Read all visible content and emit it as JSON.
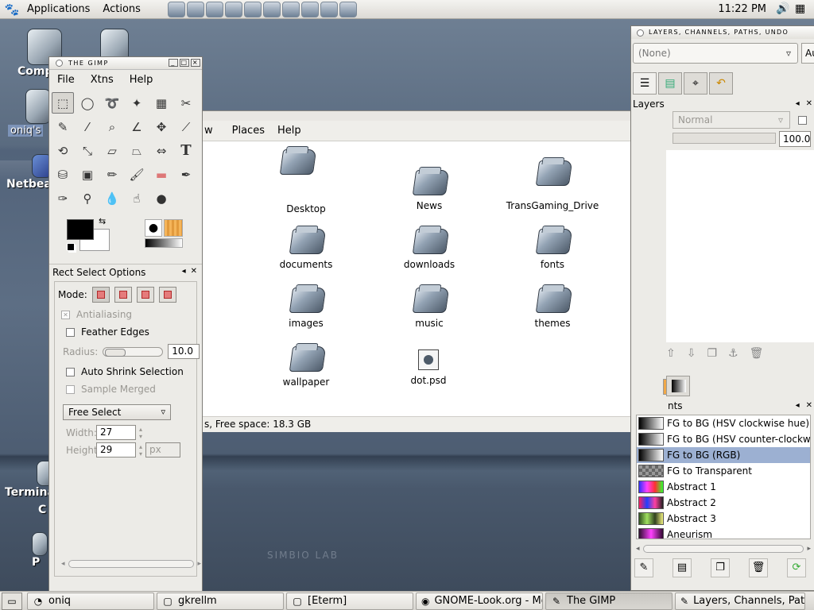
{
  "top_panel": {
    "menus": [
      "Applications",
      "Actions"
    ],
    "clock": "11:22 PM"
  },
  "desktop": {
    "icons": [
      "Comp",
      "oniq's",
      "Netbea",
      "Terminal",
      "C",
      "P"
    ],
    "watermark": "SIMBIO LAB"
  },
  "nautilus": {
    "menus": [
      "w",
      "Places",
      "Help"
    ],
    "files": [
      "Desktop",
      "News",
      "TransGaming_Drive",
      "documents",
      "downloads",
      "fonts",
      "images",
      "music",
      "themes",
      "wallpaper",
      "dot.psd"
    ],
    "status": "s, Free space: 18.3 GB"
  },
  "gimp": {
    "title": "THE GIMP",
    "menus": [
      "File",
      "Xtns",
      "Help"
    ],
    "tool_options_title": "Rect Select Options",
    "mode_label": "Mode:",
    "antialiasing": "Antialiasing",
    "feather_edges": "Feather Edges",
    "radius_label": "Radius:",
    "radius_value": "10.0",
    "auto_shrink": "Auto Shrink Selection",
    "sample_merged": "Sample Merged",
    "select_mode": "Free Select",
    "width_label": "Width:",
    "width_value": "27",
    "height_label": "Height:",
    "height_value": "29",
    "unit": "px"
  },
  "layers_dock": {
    "title": "LAYERS, CHANNELS, PATHS, UNDO",
    "image_combo": "(None)",
    "auto_btn": "Au",
    "layers_label": "Layers",
    "mode": "Normal",
    "opacity": "100.0",
    "gradients_label": "nts",
    "gradients": [
      {
        "name": "FG to BG (HSV clockwise hue)",
        "selected": false
      },
      {
        "name": "FG to BG (HSV counter-clockwise",
        "selected": false
      },
      {
        "name": "FG to BG (RGB)",
        "selected": true
      },
      {
        "name": "FG to Transparent",
        "selected": false
      },
      {
        "name": "Abstract 1",
        "selected": false
      },
      {
        "name": "Abstract 2",
        "selected": false
      },
      {
        "name": "Abstract 3",
        "selected": false
      },
      {
        "name": "Aneurism",
        "selected": false
      }
    ]
  },
  "taskbar": {
    "tasks": [
      "oniq",
      "gkrellm",
      "[Eterm]",
      "GNOME-Look.org - Mozill",
      "The GIMP",
      "Layers, Channels, Paths"
    ]
  }
}
